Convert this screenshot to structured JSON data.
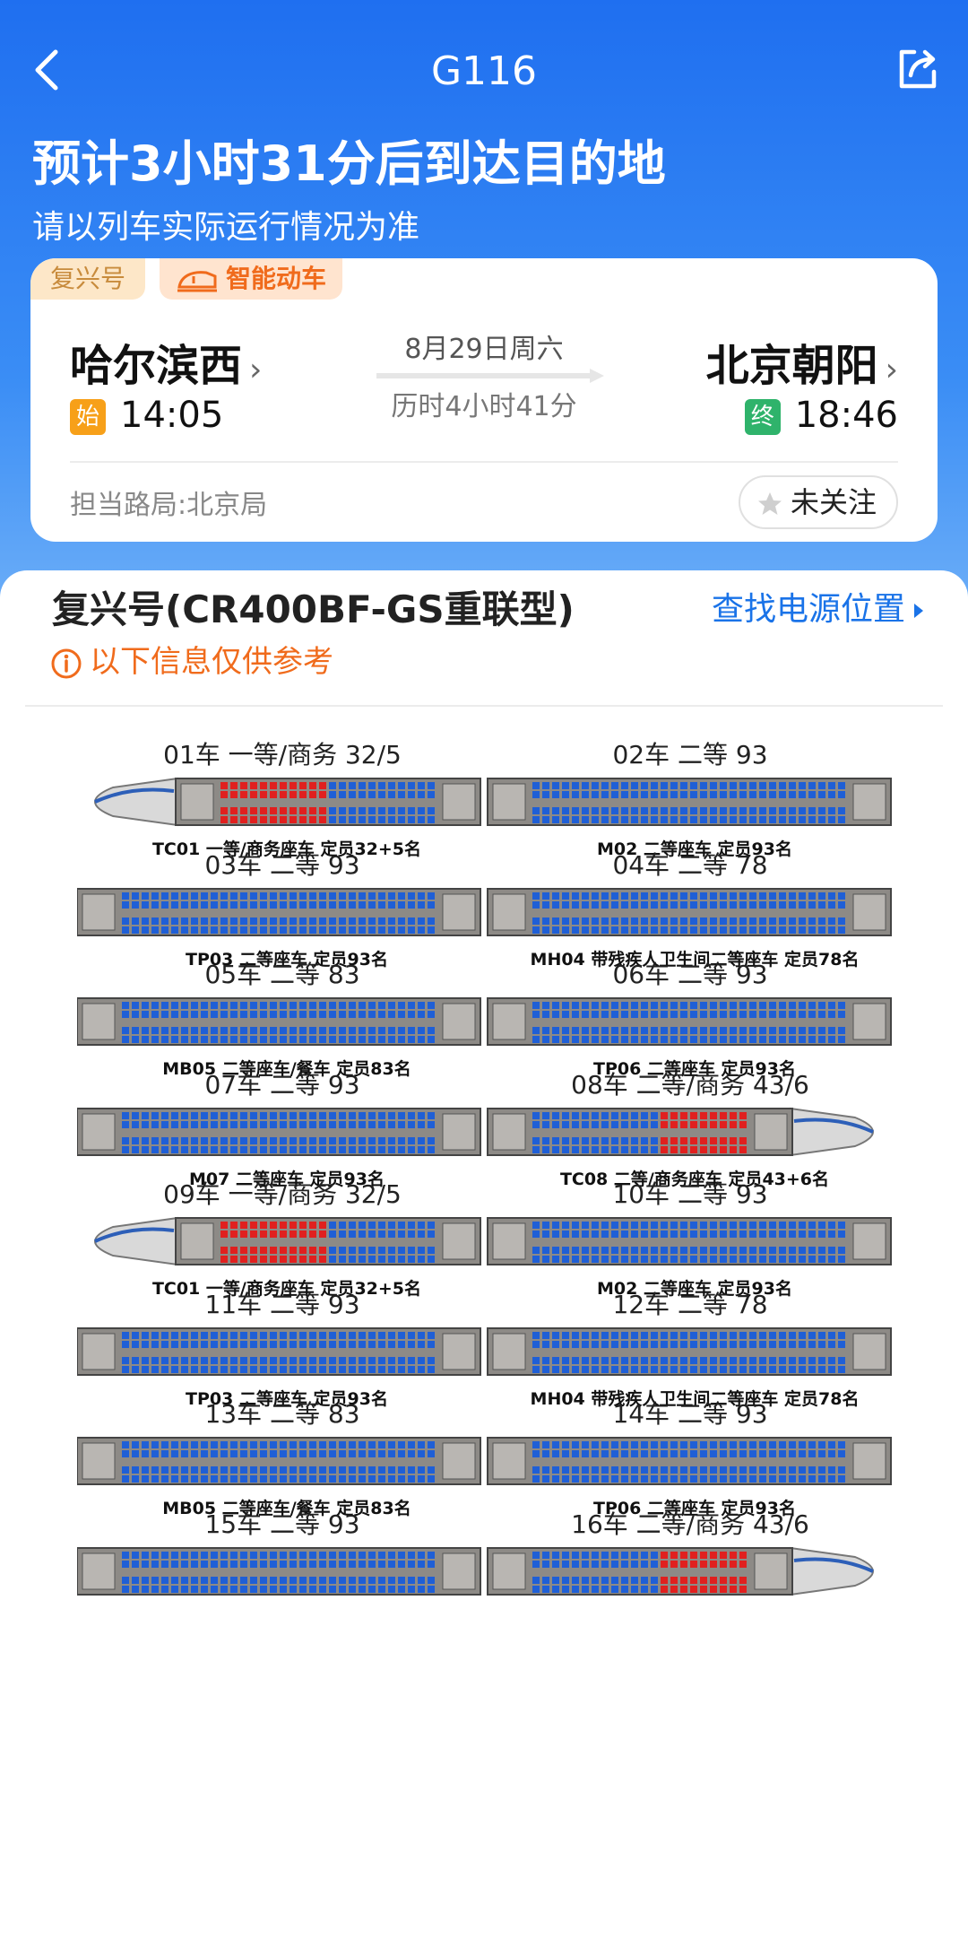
{
  "header": {
    "train_no": "G116",
    "eta_text": "预计3小时31分后到达目的地",
    "note": "请以列车实际运行情况为准"
  },
  "trip": {
    "brand_tag": "复兴号",
    "smart_tag": "智能动车",
    "from_station": "哈尔滨西",
    "to_station": "北京朝阳",
    "start_badge": "始",
    "end_badge": "终",
    "dep_time": "14:05",
    "arr_time": "18:46",
    "date": "8月29日周六",
    "duration": "历时4小时41分",
    "bureau": "担当路局:北京局",
    "follow_label": "未关注"
  },
  "consist": {
    "model": "复兴号(CR400BF-GS重联型)",
    "power_link": "查找电源位置",
    "warning": "以下信息仅供参考",
    "pairs": [
      {
        "l_label": "01车 一等/商务 32/5",
        "r_label": "02车 二等 93",
        "l_cap": "TC01 一等/商务座车 定员32+5名",
        "r_cap": "M02 二等座车 定员93名"
      },
      {
        "l_label": "03车 二等 93",
        "r_label": "04车 二等 78",
        "l_cap": "TP03 二等座车 定员93名",
        "r_cap": "MH04 带残疾人卫生间二等座车 定员78名"
      },
      {
        "l_label": "05车 二等 83",
        "r_label": "06车 二等 93",
        "l_cap": "MB05 二等座车/餐车 定员83名",
        "r_cap": "TP06 二等座车 定员93名"
      },
      {
        "l_label": "07车 二等 93",
        "r_label": "08车 二等/商务 43/6",
        "l_cap": "M07 二等座车 定员93名",
        "r_cap": "TC08 二等/商务座车 定员43+6名"
      },
      {
        "l_label": "09车 一等/商务 32/5",
        "r_label": "10车 二等 93",
        "l_cap": "TC01 一等/商务座车 定员32+5名",
        "r_cap": "M02 二等座车 定员93名"
      },
      {
        "l_label": "11车 二等 93",
        "r_label": "12车 二等 78",
        "l_cap": "TP03 二等座车 定员93名",
        "r_cap": "MH04 带残疾人卫生间二等座车 定员78名"
      },
      {
        "l_label": "13车 二等 83",
        "r_label": "14车 二等 93",
        "l_cap": "MB05 二等座车/餐车 定员83名",
        "r_cap": "TP06 二等座车 定员93名"
      },
      {
        "l_label": "15车 二等 93",
        "r_label": "16车 二等/商务 43/6",
        "l_cap": "",
        "r_cap": ""
      }
    ]
  },
  "colors": {
    "primary": "#1f6ff0",
    "link": "#1a73e8",
    "warning": "#f06b1c",
    "seat_second": "#1f5fd6",
    "seat_first": "#e0201f"
  }
}
